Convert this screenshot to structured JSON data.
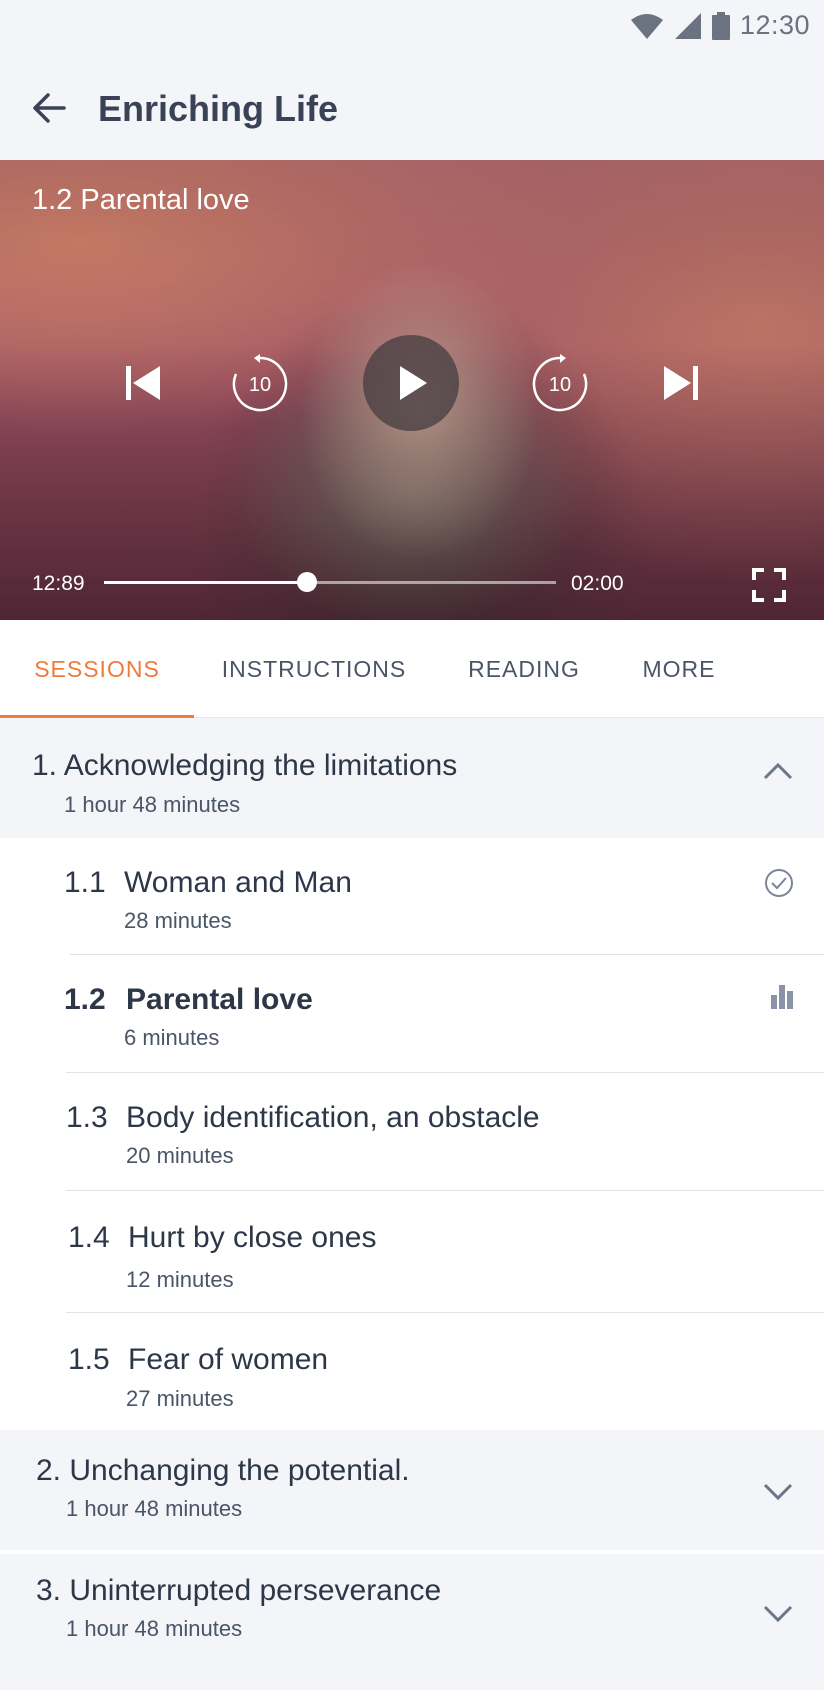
{
  "status_bar": {
    "time": "12:30"
  },
  "app_bar": {
    "title": "Enriching Life"
  },
  "player": {
    "now_playing": "1.2 Parental love",
    "elapsed": "12:89",
    "duration": "02:00",
    "progress": 0.45,
    "rewind_seconds": "10",
    "forward_seconds": "10"
  },
  "tabs": [
    {
      "label": "SESSIONS",
      "active": true
    },
    {
      "label": "INSTRUCTIONS",
      "active": false
    },
    {
      "label": "READING",
      "active": false
    },
    {
      "label": "MORE",
      "active": false
    }
  ],
  "sections": [
    {
      "title": "1. Acknowledging the limitations",
      "duration": "1 hour 48 minutes",
      "expanded": true,
      "sessions": [
        {
          "number": "1.1",
          "title": "Woman and Man",
          "duration": "28 minutes",
          "status": "completed",
          "icon": "check-circle-icon"
        },
        {
          "number": "1.2",
          "title": "Parental love",
          "duration": "6 minutes",
          "status": "playing",
          "icon": "equalizer-icon"
        },
        {
          "number": "1.3",
          "title": "Body identification, an obstacle",
          "duration": "20 minutes",
          "status": ""
        },
        {
          "number": "1.4",
          "title": "Hurt by close ones",
          "duration": "12 minutes",
          "status": ""
        },
        {
          "number": "1.5",
          "title": "Fear of women",
          "duration": "27 minutes",
          "status": ""
        }
      ]
    },
    {
      "title": "2. Unchanging the potential.",
      "duration": "1 hour 48 minutes",
      "expanded": false
    },
    {
      "title": "3. Uninterrupted perseverance",
      "duration": "1 hour 48 minutes",
      "expanded": false
    }
  ],
  "colors": {
    "accent": "#ef7a3a",
    "text": "#2d3748",
    "background": "#f3f5f8"
  }
}
